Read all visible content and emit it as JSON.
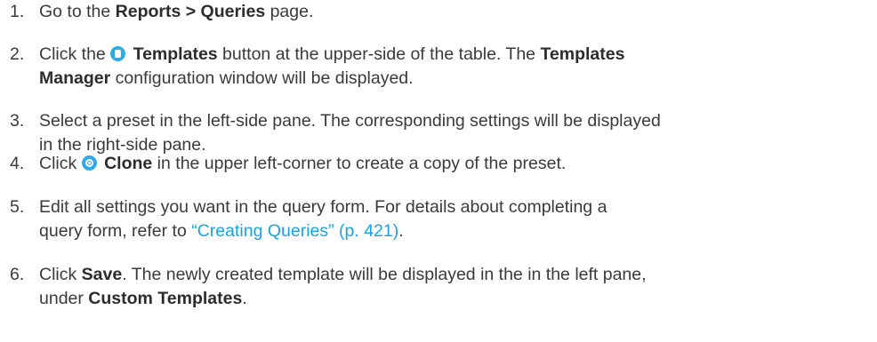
{
  "steps": [
    {
      "number": "1.",
      "t1": "Go to the ",
      "b1": "Reports > Queries",
      "t2": " page."
    },
    {
      "number": "2.",
      "t1": "Click the ",
      "icon": "templates-icon",
      "b1": "Templates",
      "t2": " button at the upper-side of the table. The ",
      "b2": "Templates",
      "b3": "Manager",
      "t3": " configuration window will be displayed."
    },
    {
      "number": "3.",
      "line1": "Select a preset in the left-side pane. The corresponding settings will be displayed",
      "line2": "in the right-side pane."
    },
    {
      "number": "4.",
      "t1": "Click ",
      "icon": "clone-icon",
      "b1": "Clone",
      "t2": " in the upper left-corner to create a copy of the preset."
    },
    {
      "number": "5.",
      "line1": "Edit all settings you want in the query form. For details about completing a",
      "line2": "query form, refer to ",
      "link": "“Creating Queries” (p. 421)",
      "t_end": "."
    },
    {
      "number": "6.",
      "t1": "Click ",
      "b1": "Save",
      "t2": ". The newly created template will be displayed in the in the left pane,",
      "t3": "under ",
      "b2": "Custom Templates",
      "t4": "."
    }
  ],
  "colors": {
    "text": "#3a3a3a",
    "link": "#1aa3e0",
    "icon": "#30a9e6"
  }
}
